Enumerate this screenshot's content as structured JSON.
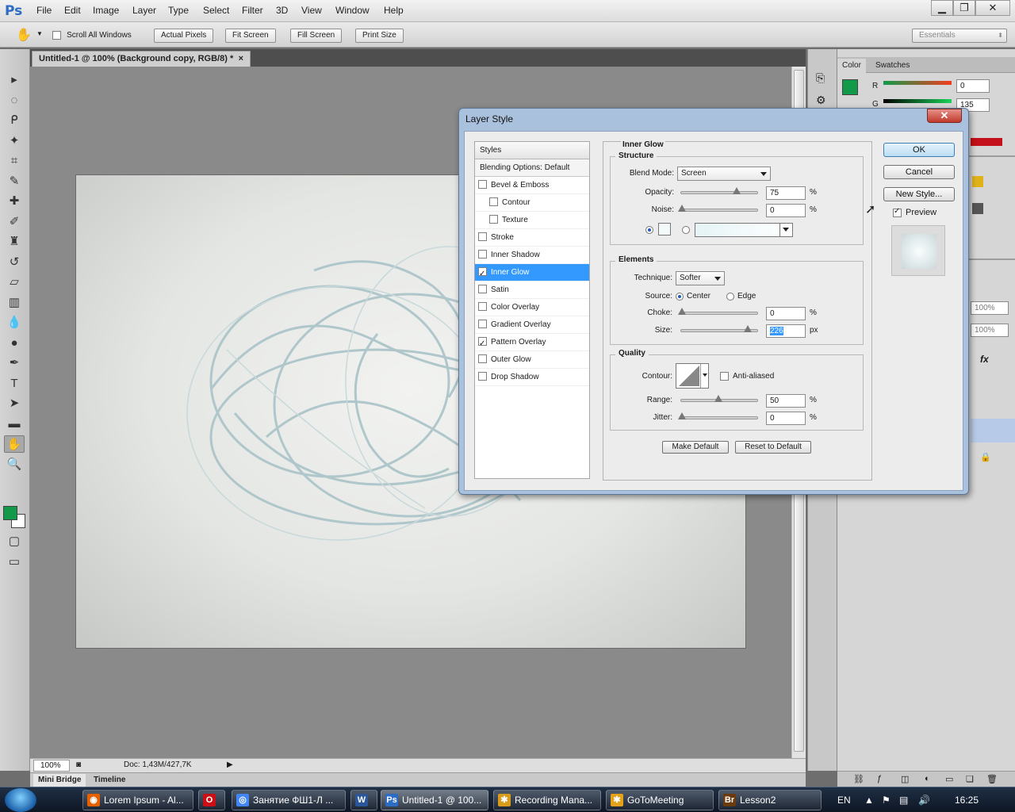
{
  "app": {
    "logo": "Ps"
  },
  "menu": [
    "File",
    "Edit",
    "Image",
    "Layer",
    "Type",
    "Select",
    "Filter",
    "3D",
    "View",
    "Window",
    "Help"
  ],
  "window_controls": {
    "minimize": "▁",
    "restore": "❐",
    "close": "✕"
  },
  "options_bar": {
    "tool_icon": "hand-icon",
    "scroll_all_label": "Scroll All Windows",
    "buttons": [
      "Actual Pixels",
      "Fit Screen",
      "Fill Screen",
      "Print Size"
    ],
    "workspace": "Essentials"
  },
  "document": {
    "tab_title": "Untitled-1 @ 100% (Background copy, RGB/8) *",
    "tab_close": "×",
    "zoom": "100%",
    "doc_info": "Doc: 1,43M/427,7K"
  },
  "bottom_tabs": [
    "Mini Bridge",
    "Timeline"
  ],
  "tools": [
    "move-icon",
    "marquee-icon",
    "lasso-icon",
    "quick-select-icon",
    "crop-icon",
    "eyedropper-icon",
    "healing-icon",
    "brush-icon",
    "stamp-icon",
    "history-brush-icon",
    "eraser-icon",
    "gradient-icon",
    "blur-icon",
    "dodge-icon",
    "pen-icon",
    "type-icon",
    "path-select-icon",
    "shape-icon",
    "hand-icon",
    "zoom-icon"
  ],
  "tool_type_glyph": "T",
  "colors": {
    "foreground": "#129a4a",
    "background": "#ffffff",
    "accent_selected": "#3399ff"
  },
  "panels": {
    "color_tab": "Color",
    "swatches_tab": "Swatches",
    "r_label": "R",
    "r_value": "0",
    "g_label": "G",
    "g_value": "135",
    "zoom_values": [
      "100%",
      "100%"
    ],
    "fx_label": "fx"
  },
  "dialog": {
    "title": "Layer Style",
    "close": "✕",
    "styles_header": "Styles",
    "blending_options": "Blending Options: Default",
    "styles": [
      {
        "label": "Bevel & Emboss",
        "checked": false,
        "indent": false,
        "selected": false
      },
      {
        "label": "Contour",
        "checked": false,
        "indent": true,
        "selected": false
      },
      {
        "label": "Texture",
        "checked": false,
        "indent": true,
        "selected": false
      },
      {
        "label": "Stroke",
        "checked": false,
        "indent": false,
        "selected": false
      },
      {
        "label": "Inner Shadow",
        "checked": false,
        "indent": false,
        "selected": false
      },
      {
        "label": "Inner Glow",
        "checked": true,
        "indent": false,
        "selected": true
      },
      {
        "label": "Satin",
        "checked": false,
        "indent": false,
        "selected": false
      },
      {
        "label": "Color Overlay",
        "checked": false,
        "indent": false,
        "selected": false
      },
      {
        "label": "Gradient Overlay",
        "checked": false,
        "indent": false,
        "selected": false
      },
      {
        "label": "Pattern Overlay",
        "checked": true,
        "indent": false,
        "selected": false
      },
      {
        "label": "Outer Glow",
        "checked": false,
        "indent": false,
        "selected": false
      },
      {
        "label": "Drop Shadow",
        "checked": false,
        "indent": false,
        "selected": false
      }
    ],
    "section_title": "Inner Glow",
    "structure": {
      "title": "Structure",
      "blend_mode_label": "Blend Mode:",
      "blend_mode": "Screen",
      "opacity_label": "Opacity:",
      "opacity": "75",
      "opacity_fraction": 0.75,
      "noise_label": "Noise:",
      "noise": "0",
      "noise_fraction": 0,
      "unit": "%"
    },
    "elements": {
      "title": "Elements",
      "technique_label": "Technique:",
      "technique": "Softer",
      "source_label": "Source:",
      "source_center": "Center",
      "source_edge": "Edge",
      "choke_label": "Choke:",
      "choke": "0",
      "choke_fraction": 0,
      "size_label": "Size:",
      "size": "226",
      "size_fraction": 0.9,
      "size_unit": "px"
    },
    "quality": {
      "title": "Quality",
      "contour_label": "Contour:",
      "anti_aliased": "Anti-aliased",
      "range_label": "Range:",
      "range": "50",
      "range_fraction": 0.5,
      "jitter_label": "Jitter:",
      "jitter": "0",
      "jitter_fraction": 0
    },
    "make_default": "Make Default",
    "reset_default": "Reset to Default",
    "buttons": {
      "ok": "OK",
      "cancel": "Cancel",
      "new_style": "New Style..."
    },
    "preview_label": "Preview"
  },
  "taskbar": {
    "tasks": [
      {
        "label": "Lorem Ipsum - Al...",
        "icon": "firefox-icon",
        "color": "#e66000",
        "glyph": "◉"
      },
      {
        "label": "",
        "icon": "opera-icon",
        "color": "#cc0f16",
        "glyph": "O"
      },
      {
        "label": "Занятие ФШ1-Л ...",
        "icon": "chrome-icon",
        "color": "#4285f4",
        "glyph": "◎"
      },
      {
        "label": "",
        "icon": "word-icon",
        "color": "#2b579a",
        "glyph": "W"
      },
      {
        "label": "Untitled-1 @ 100...",
        "icon": "photoshop-icon",
        "color": "#2b6cc4",
        "glyph": "Ps"
      },
      {
        "label": "Recording Mana...",
        "icon": "recording-icon",
        "color": "#d89b1a",
        "glyph": "✱"
      },
      {
        "label": "GoToMeeting",
        "icon": "gotomeeting-icon",
        "color": "#e3a21a",
        "glyph": "✱"
      },
      {
        "label": "Lesson2",
        "icon": "bridge-icon",
        "color": "#6b3b0f",
        "glyph": "Br"
      }
    ],
    "lang": "EN",
    "clock": "16:25"
  }
}
